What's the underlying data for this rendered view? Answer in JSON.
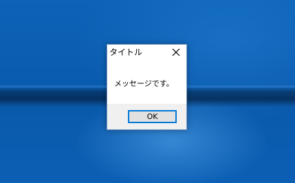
{
  "dialog": {
    "title": "タイトル",
    "message": "メッセージです。",
    "ok_label": "OK",
    "close_icon": "close-icon"
  },
  "colors": {
    "desktop": "#0a5cb0",
    "accent": "#0078d7",
    "footer": "#f0f0f0",
    "button_face": "#e1e1e1"
  }
}
